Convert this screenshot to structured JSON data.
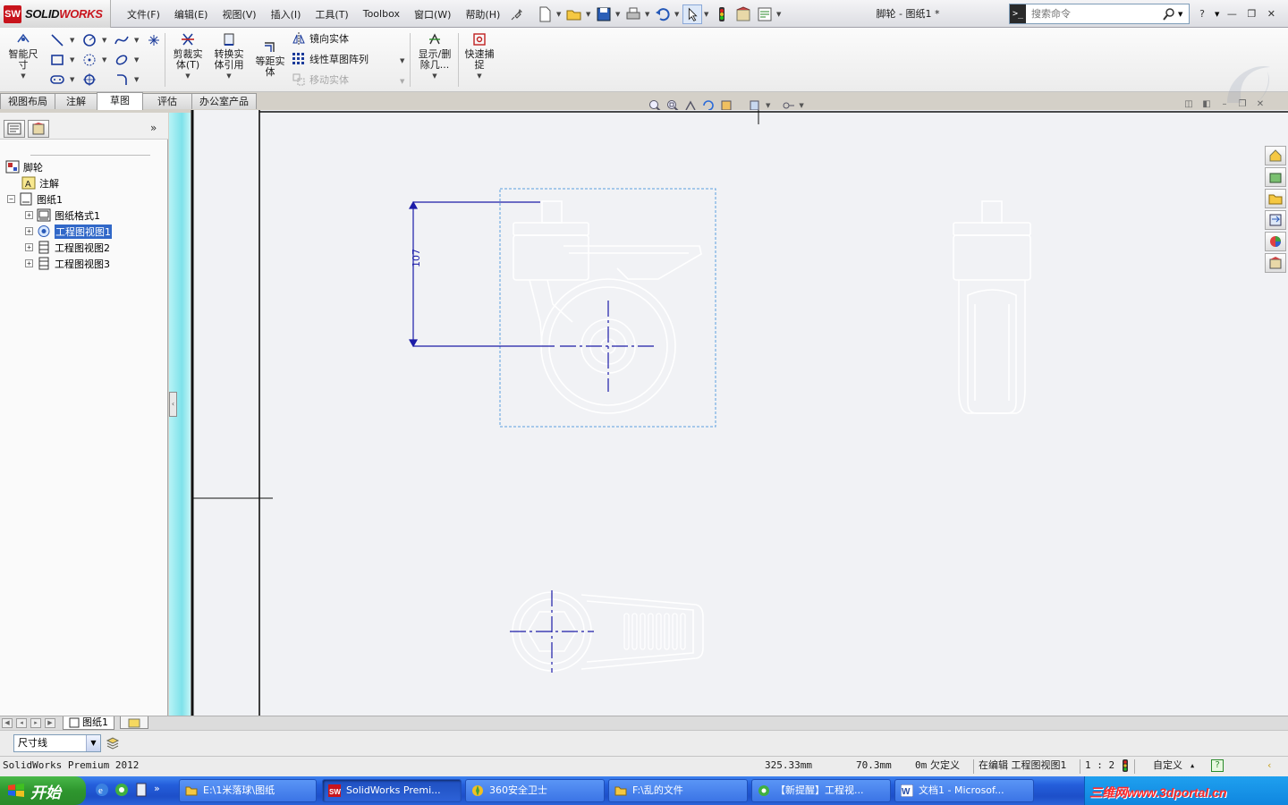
{
  "app": {
    "brand_prefix": "SOLID",
    "brand_suffix": "WORKS",
    "logo_mark": "SW",
    "document_title": "脚轮 - 图纸1 *"
  },
  "menu": [
    "文件(F)",
    "编辑(E)",
    "视图(V)",
    "插入(I)",
    "工具(T)",
    "Toolbox",
    "窗口(W)",
    "帮助(H)"
  ],
  "search": {
    "placeholder": "搜索命令"
  },
  "command_manager": {
    "smart_dim": "智能尺寸",
    "trim": "剪裁实体(T)",
    "convert": "转换实体引用",
    "offset": "等距实体",
    "mirror": "镜向实体",
    "linear_pattern": "线性草图阵列",
    "move": "移动实体",
    "show_delete": "显示/删除几...",
    "quick_snap": "快速捕捉"
  },
  "tabs": [
    {
      "label": "视图布局",
      "active": false
    },
    {
      "label": "注解",
      "active": false
    },
    {
      "label": "草图",
      "active": true
    },
    {
      "label": "评估",
      "active": false
    },
    {
      "label": "办公室产品",
      "active": false
    }
  ],
  "tree": {
    "root": "脚轮",
    "annotations": "注解",
    "sheet": "图纸1",
    "sheet_format": "图纸格式1",
    "view1": "工程图视图1",
    "view2": "工程图视图2",
    "view3": "工程图视图3"
  },
  "drawing": {
    "dimension_value": "107",
    "line_color": "#ffffff",
    "dimension_color": "#1c1ca8",
    "centerline_color": "#1c1ca8",
    "selection_box_color": "#5aa0e0",
    "background_color": "#f1f2f5"
  },
  "sheet_tabs": {
    "current": "图纸1"
  },
  "property_bar": {
    "layer": "尺寸线"
  },
  "status": {
    "product": "SolidWorks Premium 2012",
    "x": "325.33mm",
    "y": "70.3mm",
    "z": "0m",
    "define_state": "欠定义",
    "editing": "在编辑 工程图视图1",
    "scale": "1 : 2",
    "units": "自定义"
  },
  "taskbar": {
    "start": "开始",
    "tasks": [
      {
        "label": "E:\\1米落球\\图纸",
        "active": false
      },
      {
        "label": "SolidWorks Premi...",
        "active": true
      },
      {
        "label": "360安全卫士",
        "active": false
      },
      {
        "label": "F:\\乱的文件",
        "active": false
      },
      {
        "label": "【新提醒】工程视...",
        "active": false
      },
      {
        "label": "文档1 - Microsof...",
        "active": false
      }
    ],
    "watermark": "三维网www.3dportal.cn"
  }
}
